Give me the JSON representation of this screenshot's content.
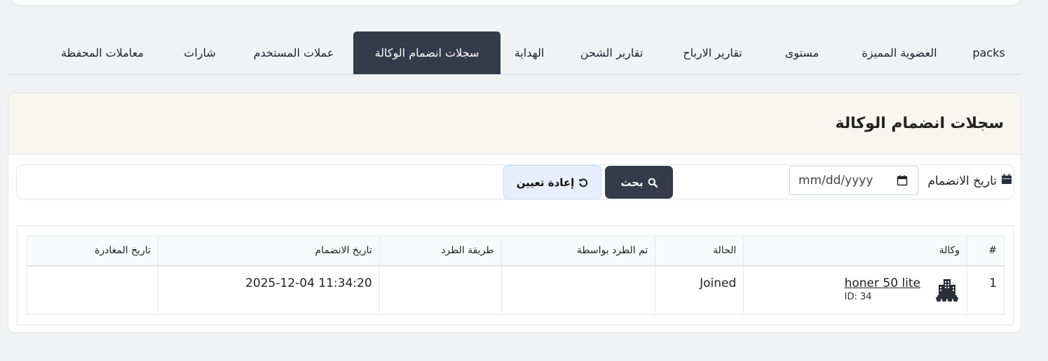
{
  "tabs": [
    {
      "label": "packs"
    },
    {
      "label": "العضوية المميزة"
    },
    {
      "label": "مستوى"
    },
    {
      "label": "تقارير الارباح"
    },
    {
      "label": "تقارير الشحن"
    },
    {
      "label": "الهداية"
    },
    {
      "label": "سجلات انضمام الوكالة",
      "active": true
    },
    {
      "label": "عملات المستخدم"
    },
    {
      "label": "شارات"
    },
    {
      "label": "معاملات المحفظة"
    }
  ],
  "panel": {
    "title": "سجلات انضمام الوكالة"
  },
  "filter": {
    "label": "تاريخ الانضمام",
    "date_placeholder": "mm/dd/yyyy",
    "search_label": "بحث",
    "reset_label": "إعادة تعيين"
  },
  "table": {
    "headers": [
      "#",
      "وكالة",
      "الحالة",
      "تم الطرد بواسطة",
      "طريقة الطرد",
      "تاريخ الانضمام",
      "تاريخ المغادرة"
    ],
    "rows": [
      {
        "index": "1",
        "agency_name": "honer 50 lite",
        "agency_id": "ID: 34",
        "status": "Joined",
        "kicked_by": "",
        "kick_method": "",
        "join_date": "2025-12-04 11:34:20",
        "leave_date": ""
      }
    ]
  },
  "colors": {
    "accent": "#343c4b",
    "panel_header": "#f8f6f0",
    "reset_bg": "#e6eefc"
  }
}
